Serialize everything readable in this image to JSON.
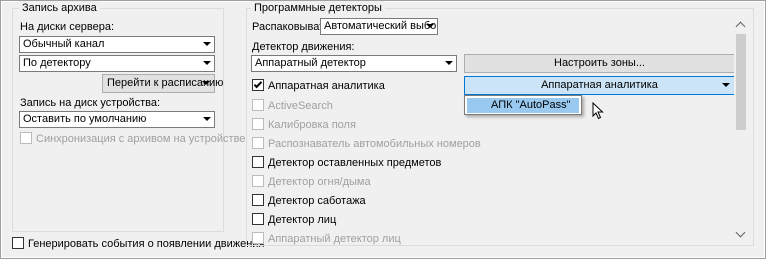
{
  "archive": {
    "legend": "Запись архива",
    "server_disks_label": "На диски сервера:",
    "channel_select": "Обычный канал",
    "mode_select": "По детектору",
    "schedule_button": "Перейти к расписанию",
    "device_disk_label": "Запись на диск устройства:",
    "device_select": "Оставить по умолчанию",
    "sync_checkbox": {
      "label": "Синхронизация с архивом на устройстве",
      "checked": false,
      "disabled": true
    }
  },
  "generate_events": {
    "label": "Генерировать события о появлении движения",
    "checked": false
  },
  "detectors": {
    "legend": "Программные детекторы",
    "unpack_label": "Распаковывать:",
    "unpack_select": "Автоматический выбор",
    "motion_label": "Детектор движения:",
    "motion_select": "Аппаратный детектор",
    "zones_button": "Настроить зоны...",
    "hw_analytics_dropdown": "Аппаратная аналитика",
    "popup_option": "АПК \"AutoPass\"",
    "items": [
      {
        "label": "Аппаратная аналитика",
        "checked": true,
        "disabled": false
      },
      {
        "label": "ActiveSearch",
        "checked": false,
        "disabled": true
      },
      {
        "label": "Калибровка поля",
        "checked": false,
        "disabled": true
      },
      {
        "label": "Распознаватель автомобильных номеров",
        "checked": false,
        "disabled": true
      },
      {
        "label": "Детектор оставленных предметов",
        "checked": false,
        "disabled": false
      },
      {
        "label": "Детектор огня/дыма",
        "checked": false,
        "disabled": true
      },
      {
        "label": "Детектор саботажа",
        "checked": false,
        "disabled": false
      },
      {
        "label": "Детектор лиц",
        "checked": false,
        "disabled": false
      },
      {
        "label": "Аппаратный детектор лиц",
        "checked": false,
        "disabled": true
      }
    ]
  },
  "colors": {
    "window_bg": "#f0f0f0",
    "selection_bg": "#cce4f7",
    "selection_border": "#0078d7",
    "popup_highlight": "#99c9ef",
    "disabled_text": "#a0a0a0"
  }
}
